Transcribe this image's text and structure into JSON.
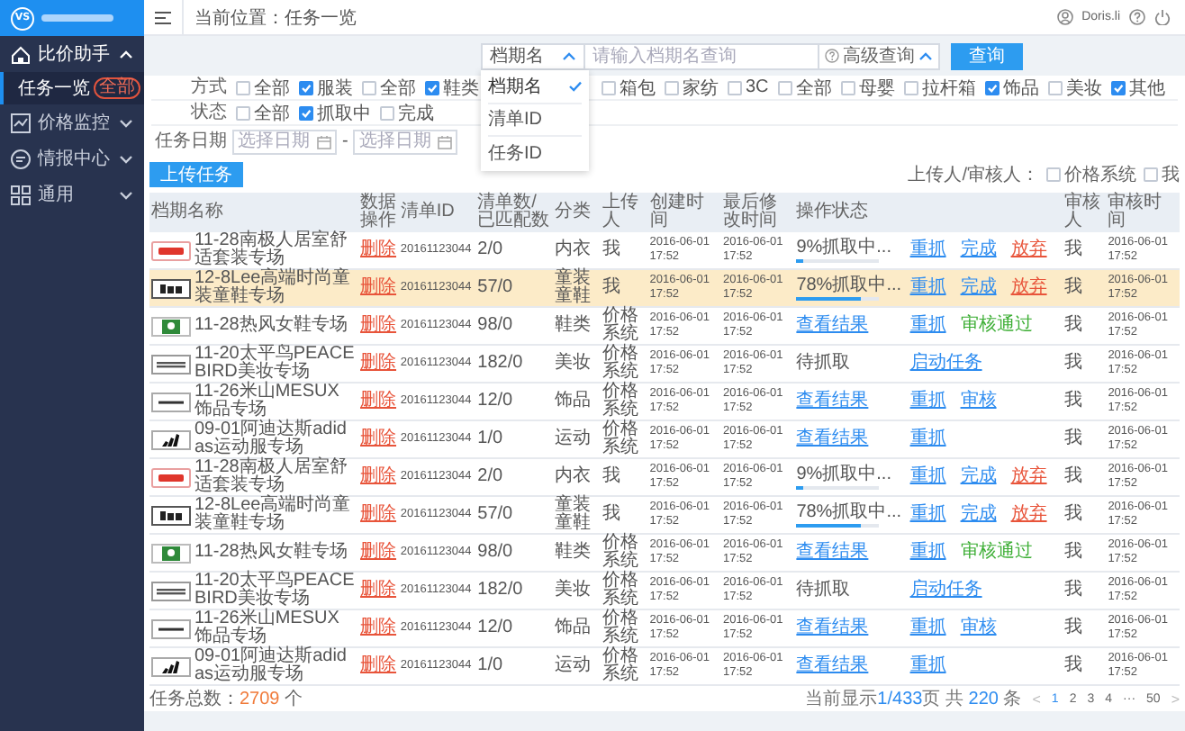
{
  "sidebar": {
    "logo_text": "VS",
    "items": [
      {
        "label": "比价助手",
        "expanded": true,
        "children": [
          {
            "label": "任务一览",
            "badge": "全部",
            "selected": true
          }
        ]
      },
      {
        "label": "价格监控",
        "expanded": false
      },
      {
        "label": "情报中心",
        "expanded": false
      },
      {
        "label": "通用",
        "expanded": false
      }
    ]
  },
  "header": {
    "breadcrumb": "当前位置：任务一览",
    "user": "Doris.li"
  },
  "search": {
    "field_select": "档期名",
    "placeholder": "请输入档期名查询",
    "advanced": "高级查询",
    "advanced_expanded": true,
    "button": "查询",
    "dropdown": {
      "open": true,
      "options": [
        {
          "label": "档期名",
          "selected": true
        },
        {
          "label": "清单ID",
          "selected": false
        },
        {
          "label": "任务ID",
          "selected": false
        }
      ]
    }
  },
  "filters": {
    "method": {
      "label": "方式",
      "options": [
        {
          "label": "全部",
          "checked": false
        },
        {
          "label": "服装",
          "checked": true
        },
        {
          "label": "全部",
          "checked": false
        },
        {
          "label": "鞋类",
          "checked": true
        },
        {
          "label": "箱包",
          "checked": false
        },
        {
          "label": "家纺",
          "checked": false
        },
        {
          "label": "3C",
          "checked": false
        },
        {
          "label": "全部",
          "checked": false
        },
        {
          "label": "母婴",
          "checked": false
        },
        {
          "label": "拉杆箱",
          "checked": false
        },
        {
          "label": "饰品",
          "checked": true
        },
        {
          "label": "美妆",
          "checked": false
        },
        {
          "label": "其他",
          "checked": true
        }
      ]
    },
    "status": {
      "label": "状态",
      "options": [
        {
          "label": "全部",
          "checked": false
        },
        {
          "label": "抓取中",
          "checked": true
        },
        {
          "label": "完成",
          "checked": false
        }
      ]
    },
    "date": {
      "label": "任务日期",
      "start_placeholder": "选择日期",
      "separator": "-",
      "end_placeholder": "选择日期"
    }
  },
  "toolbar": {
    "upload_button": "上传任务",
    "uploader_label": "上传人/审核人：",
    "uploader_options": [
      {
        "label": "价格系统",
        "checked": false
      },
      {
        "label": "我",
        "checked": false
      }
    ]
  },
  "table": {
    "columns": [
      "档期名称",
      "数据操作",
      "清单ID",
      "清单数/已匹配数",
      "分类",
      "上传人",
      "创建时间",
      "最后修改时间",
      "操作状态",
      "审核人",
      "审核时间"
    ],
    "rows": [
      {
        "name": "11-28南极人居室舒适套装专场",
        "logo": {
          "kind": "nanjiren"
        },
        "operation": "删除",
        "list_id": "20161123044",
        "counts": "2/0",
        "category": "内衣",
        "uploader": "我",
        "created": "2016-06-01 17:52",
        "modified": "2016-06-01 17:52",
        "status": {
          "kind": "progress",
          "text": "9%抓取中...",
          "level": 0.09
        },
        "actions": [
          {
            "label": "重抓",
            "kind": "link"
          },
          {
            "label": "完成",
            "kind": "link"
          },
          {
            "label": "放弃",
            "kind": "danger"
          }
        ],
        "reviewer": "我",
        "reviewed_at": "2016-06-01 17:52",
        "highlighted": false
      },
      {
        "name": "12-8Lee高端时尚童装童鞋专场",
        "logo": {
          "kind": "lee"
        },
        "operation": "删除",
        "list_id": "20161123044",
        "counts": "57/0",
        "category": "童装童鞋",
        "uploader": "我",
        "created": "2016-06-01 17:52",
        "modified": "2016-06-01 17:52",
        "status": {
          "kind": "progress",
          "text": "78%抓取中...",
          "level": 0.78
        },
        "actions": [
          {
            "label": "重抓",
            "kind": "link"
          },
          {
            "label": "完成",
            "kind": "link"
          },
          {
            "label": "放弃",
            "kind": "danger"
          }
        ],
        "reviewer": "我",
        "reviewed_at": "2016-06-01 17:52",
        "highlighted": true
      },
      {
        "name": "11-28热风女鞋专场",
        "logo": {
          "kind": "hotwind"
        },
        "operation": "删除",
        "list_id": "20161123044",
        "counts": "98/0",
        "category": "鞋类",
        "uploader": "价格系统",
        "created": "2016-06-01 17:52",
        "modified": "2016-06-01 17:52",
        "status": {
          "kind": "link",
          "text": "查看结果"
        },
        "actions": [
          {
            "label": "重抓",
            "kind": "link"
          },
          {
            "label": "审核通过",
            "kind": "approved"
          }
        ],
        "reviewer": "我",
        "reviewed_at": "2016-06-01 17:52",
        "highlighted": false
      },
      {
        "name": "11-20太平鸟PEACE BIRD美妆专场",
        "logo": {
          "kind": "peacebird"
        },
        "operation": "删除",
        "list_id": "20161123044",
        "counts": "182/0",
        "category": "美妆",
        "uploader": "价格系统",
        "created": "2016-06-01 17:52",
        "modified": "2016-06-01 17:52",
        "status": {
          "kind": "text",
          "text": "待抓取"
        },
        "actions": [
          {
            "label": "启动任务",
            "kind": "link"
          }
        ],
        "reviewer": "我",
        "reviewed_at": "2016-06-01 17:52",
        "highlighted": false
      },
      {
        "name": "11-26米山MESUX饰品专场",
        "logo": {
          "kind": "mesux"
        },
        "operation": "删除",
        "list_id": "20161123044",
        "counts": "12/0",
        "category": "饰品",
        "uploader": "价格系统",
        "created": "2016-06-01 17:52",
        "modified": "2016-06-01 17:52",
        "status": {
          "kind": "link",
          "text": "查看结果"
        },
        "actions": [
          {
            "label": "重抓",
            "kind": "link"
          },
          {
            "label": "审核",
            "kind": "link"
          }
        ],
        "reviewer": "我",
        "reviewed_at": "2016-06-01 17:52",
        "highlighted": false
      },
      {
        "name": "09-01阿迪达斯adidas运动服专场",
        "logo": {
          "kind": "adidas"
        },
        "operation": "删除",
        "list_id": "20161123044",
        "counts": "1/0",
        "category": "运动",
        "uploader": "价格系统",
        "created": "2016-06-01 17:52",
        "modified": "2016-06-01 17:52",
        "status": {
          "kind": "link",
          "text": "查看结果"
        },
        "actions": [
          {
            "label": "重抓",
            "kind": "link"
          }
        ],
        "reviewer": "我",
        "reviewed_at": "2016-06-01 17:52",
        "highlighted": false
      },
      {
        "name": "11-28南极人居室舒适套装专场",
        "logo": {
          "kind": "nanjiren"
        },
        "operation": "删除",
        "list_id": "20161123044",
        "counts": "2/0",
        "category": "内衣",
        "uploader": "我",
        "created": "2016-06-01 17:52",
        "modified": "2016-06-01 17:52",
        "status": {
          "kind": "progress",
          "text": "9%抓取中...",
          "level": 0.09
        },
        "actions": [
          {
            "label": "重抓",
            "kind": "link"
          },
          {
            "label": "完成",
            "kind": "link"
          },
          {
            "label": "放弃",
            "kind": "danger"
          }
        ],
        "reviewer": "我",
        "reviewed_at": "2016-06-01 17:52",
        "highlighted": false
      },
      {
        "name": "12-8Lee高端时尚童装童鞋专场",
        "logo": {
          "kind": "lee"
        },
        "operation": "删除",
        "list_id": "20161123044",
        "counts": "57/0",
        "category": "童装童鞋",
        "uploader": "我",
        "created": "2016-06-01 17:52",
        "modified": "2016-06-01 17:52",
        "status": {
          "kind": "progress",
          "text": "78%抓取中...",
          "level": 0.78
        },
        "actions": [
          {
            "label": "重抓",
            "kind": "link"
          },
          {
            "label": "完成",
            "kind": "link"
          },
          {
            "label": "放弃",
            "kind": "danger"
          }
        ],
        "reviewer": "我",
        "reviewed_at": "2016-06-01 17:52",
        "highlighted": false
      },
      {
        "name": "11-28热风女鞋专场",
        "logo": {
          "kind": "hotwind"
        },
        "operation": "删除",
        "list_id": "20161123044",
        "counts": "98/0",
        "category": "鞋类",
        "uploader": "价格系统",
        "created": "2016-06-01 17:52",
        "modified": "2016-06-01 17:52",
        "status": {
          "kind": "link",
          "text": "查看结果"
        },
        "actions": [
          {
            "label": "重抓",
            "kind": "link"
          },
          {
            "label": "审核通过",
            "kind": "approved"
          }
        ],
        "reviewer": "我",
        "reviewed_at": "2016-06-01 17:52",
        "highlighted": false
      },
      {
        "name": "11-20太平鸟PEACE BIRD美妆专场",
        "logo": {
          "kind": "peacebird"
        },
        "operation": "删除",
        "list_id": "20161123044",
        "counts": "182/0",
        "category": "美妆",
        "uploader": "价格系统",
        "created": "2016-06-01 17:52",
        "modified": "2016-06-01 17:52",
        "status": {
          "kind": "text",
          "text": "待抓取"
        },
        "actions": [
          {
            "label": "启动任务",
            "kind": "link"
          }
        ],
        "reviewer": "我",
        "reviewed_at": "2016-06-01 17:52",
        "highlighted": false
      },
      {
        "name": "11-26米山MESUX饰品专场",
        "logo": {
          "kind": "mesux"
        },
        "operation": "删除",
        "list_id": "20161123044",
        "counts": "12/0",
        "category": "饰品",
        "uploader": "价格系统",
        "created": "2016-06-01 17:52",
        "modified": "2016-06-01 17:52",
        "status": {
          "kind": "link",
          "text": "查看结果"
        },
        "actions": [
          {
            "label": "重抓",
            "kind": "link"
          },
          {
            "label": "审核",
            "kind": "link"
          }
        ],
        "reviewer": "我",
        "reviewed_at": "2016-06-01 17:52",
        "highlighted": false
      },
      {
        "name": "09-01阿迪达斯adidas运动服专场",
        "logo": {
          "kind": "adidas"
        },
        "operation": "删除",
        "list_id": "20161123044",
        "counts": "1/0",
        "category": "运动",
        "uploader": "价格系统",
        "created": "2016-06-01 17:52",
        "modified": "2016-06-01 17:52",
        "status": {
          "kind": "link",
          "text": "查看结果"
        },
        "actions": [
          {
            "label": "重抓",
            "kind": "link"
          }
        ],
        "reviewer": "我",
        "reviewed_at": "2016-06-01 17:52",
        "highlighted": false
      }
    ]
  },
  "footer": {
    "total_label": "任务总数：",
    "total": "2709",
    "total_unit": "个",
    "pagination": {
      "prefix": "当前显示",
      "page": "1/433",
      "mid": "页 共",
      "count": "220",
      "suffix": "条",
      "prev": "<",
      "next": ">",
      "pages": [
        {
          "label": "1",
          "selected": true
        },
        {
          "label": "2",
          "selected": false
        },
        {
          "label": "3",
          "selected": false
        },
        {
          "label": "4",
          "selected": false
        },
        {
          "label": "···",
          "selected": false
        },
        {
          "label": "50",
          "selected": false
        }
      ]
    }
  }
}
